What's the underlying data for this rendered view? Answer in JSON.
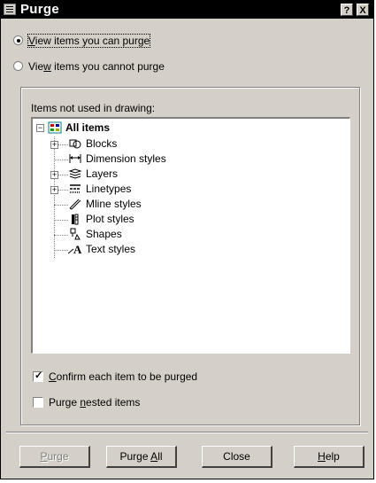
{
  "window": {
    "title": "Purge",
    "help_glyph": "?",
    "close_glyph": "X"
  },
  "view_options": [
    {
      "pre": "",
      "accel": "V",
      "post": "iew items you can purge",
      "selected": true
    },
    {
      "pre": "Vie",
      "accel": "w",
      "post": " items you cannot purge",
      "selected": false
    }
  ],
  "group_label": "Items not used in drawing:",
  "tree": {
    "root": {
      "label": "All items",
      "expanded": true
    },
    "items": [
      {
        "label": "Blocks",
        "icon": "blocks-icon",
        "expandable": true
      },
      {
        "label": "Dimension styles",
        "icon": "dimension-styles-icon",
        "expandable": false
      },
      {
        "label": "Layers",
        "icon": "layers-icon",
        "expandable": true
      },
      {
        "label": "Linetypes",
        "icon": "linetypes-icon",
        "expandable": true
      },
      {
        "label": "Mline styles",
        "icon": "mline-styles-icon",
        "expandable": false
      },
      {
        "label": "Plot styles",
        "icon": "plot-styles-icon",
        "expandable": false
      },
      {
        "label": "Shapes",
        "icon": "shapes-icon",
        "expandable": false
      },
      {
        "label": "Text styles",
        "icon": "text-styles-icon",
        "expandable": false
      }
    ]
  },
  "options": {
    "confirm": {
      "pre": "",
      "accel": "C",
      "post": "onfirm each item to be purged",
      "checked": true
    },
    "nested": {
      "pre": "Purge ",
      "accel": "n",
      "post": "ested items",
      "checked": false
    }
  },
  "buttons": {
    "purge": {
      "pre": "",
      "accel": "P",
      "post": "urge",
      "enabled": false
    },
    "purge_all": {
      "pre": "Purge ",
      "accel": "A",
      "post": "ll",
      "enabled": true
    },
    "close": {
      "label": "Close"
    },
    "help": {
      "pre": "",
      "accel": "H",
      "post": "elp"
    }
  },
  "colors": {
    "face": "#d4d0c8",
    "titlebar": "#000000",
    "disabled_text": "#808080"
  }
}
